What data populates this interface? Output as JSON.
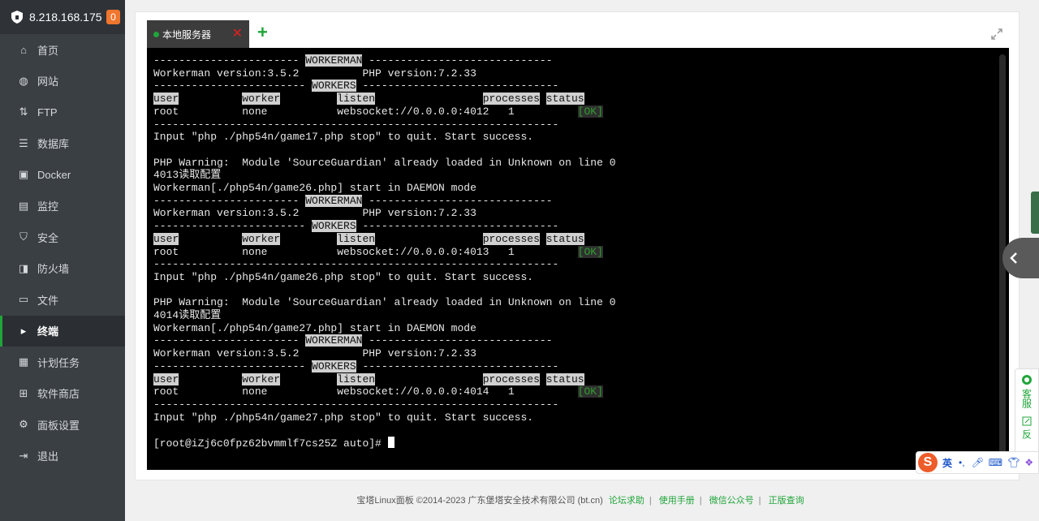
{
  "sidebar": {
    "server_ip": "8.218.168.175",
    "badge": "0",
    "items": [
      {
        "label": "首页",
        "icon": "home-icon"
      },
      {
        "label": "网站",
        "icon": "globe-icon"
      },
      {
        "label": "FTP",
        "icon": "ftp-icon"
      },
      {
        "label": "数据库",
        "icon": "database-icon"
      },
      {
        "label": "Docker",
        "icon": "docker-icon"
      },
      {
        "label": "监控",
        "icon": "monitor-icon"
      },
      {
        "label": "安全",
        "icon": "shield-icon"
      },
      {
        "label": "防火墙",
        "icon": "firewall-icon"
      },
      {
        "label": "文件",
        "icon": "folder-icon"
      },
      {
        "label": "终端",
        "icon": "terminal-icon",
        "active": true
      },
      {
        "label": "计划任务",
        "icon": "calendar-icon"
      },
      {
        "label": "软件商店",
        "icon": "apps-icon"
      },
      {
        "label": "面板设置",
        "icon": "gear-icon"
      },
      {
        "label": "退出",
        "icon": "logout-icon"
      }
    ]
  },
  "terminal": {
    "tab_label": "本地服务器",
    "prompt": "[root@iZj6c0fpz62bvmmlf7cs25Z auto]# ",
    "lines": [
      "----------------------- WORKERMAN -----------------------------",
      "Workerman version:3.5.2          PHP version:7.2.33",
      "------------------------ WORKERS -------------------------------",
      "user          worker         listen                 processes status",
      "root          none           websocket://0.0.0.0:4012   1          [OK]",
      "----------------------------------------------------------------",
      "Input \"php ./php54n/game17.php stop\" to quit. Start success.",
      "",
      "PHP Warning:  Module 'SourceGuardian' already loaded in Unknown on line 0",
      "4013读取配置",
      "Workerman[./php54n/game26.php] start in DAEMON mode",
      "----------------------- WORKERMAN -----------------------------",
      "Workerman version:3.5.2          PHP version:7.2.33",
      "------------------------ WORKERS -------------------------------",
      "user          worker         listen                 processes status",
      "root          none           websocket://0.0.0.0:4013   1          [OK]",
      "----------------------------------------------------------------",
      "Input \"php ./php54n/game26.php stop\" to quit. Start success.",
      "",
      "PHP Warning:  Module 'SourceGuardian' already loaded in Unknown on line 0",
      "4014读取配置",
      "Workerman[./php54n/game27.php] start in DAEMON mode",
      "----------------------- WORKERMAN -----------------------------",
      "Workerman version:3.5.2          PHP version:7.2.33",
      "------------------------ WORKERS -------------------------------",
      "user          worker         listen                 processes status",
      "root          none           websocket://0.0.0.0:4014   1          [OK]",
      "----------------------------------------------------------------",
      "Input \"php ./php54n/game27.php stop\" to quit. Start success.",
      ""
    ]
  },
  "widgets": {
    "service_label": "客服",
    "feedback_label": "反",
    "ime_label": "英"
  },
  "footer": {
    "copyright": "宝塔Linux面板 ©2014-2023 广东堡塔安全技术有限公司 (bt.cn)",
    "links": [
      "论坛求助",
      "使用手册",
      "微信公众号",
      "正版查询"
    ]
  },
  "colors": {
    "accent": "#20a53a",
    "sidebar_bg": "#3a3f44",
    "badge": "#f0762e",
    "terminal_bg": "#000000"
  }
}
